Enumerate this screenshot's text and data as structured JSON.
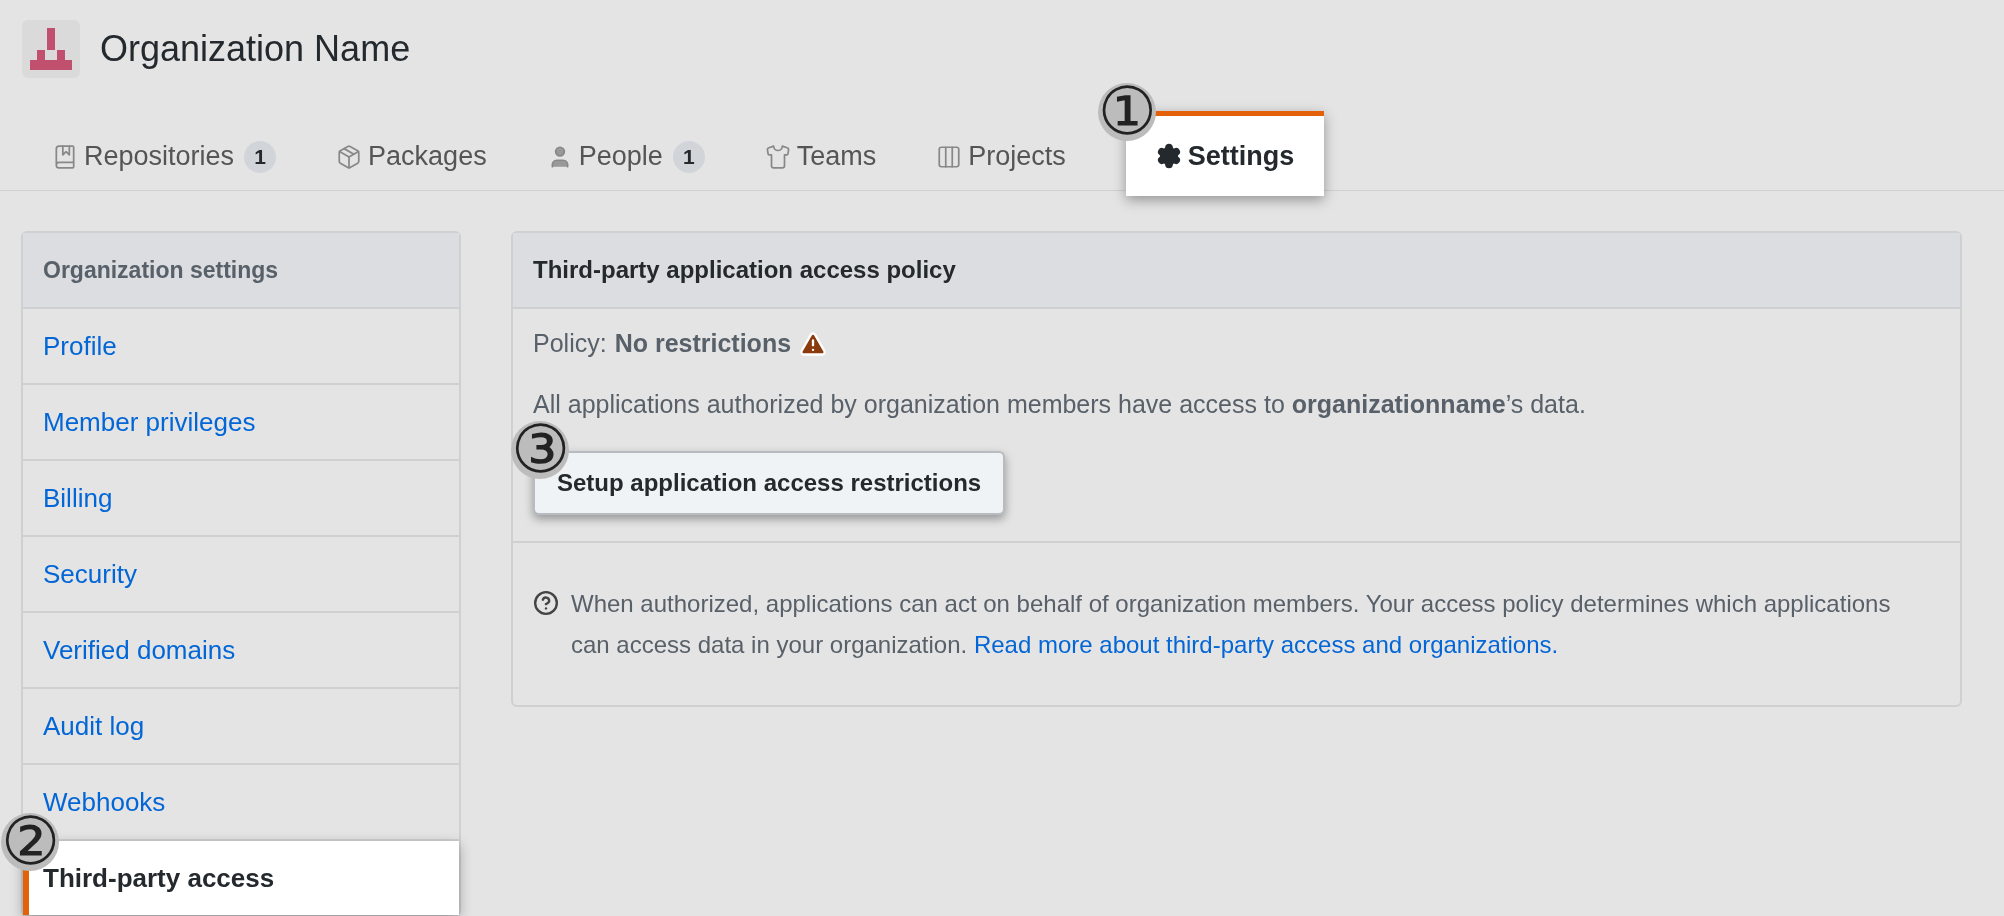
{
  "org": {
    "name": "Organization Name"
  },
  "tabs": [
    {
      "label": "Repositories",
      "count": "1",
      "selected": false
    },
    {
      "label": "Packages",
      "selected": false
    },
    {
      "label": "People",
      "count": "1",
      "selected": false
    },
    {
      "label": "Teams",
      "selected": false
    },
    {
      "label": "Projects",
      "selected": false
    },
    {
      "label": "Settings",
      "selected": true,
      "callout": "①"
    }
  ],
  "sidebar": {
    "title": "Organization settings",
    "items": [
      {
        "label": "Profile",
        "selected": false
      },
      {
        "label": "Member privileges",
        "selected": false
      },
      {
        "label": "Billing",
        "selected": false
      },
      {
        "label": "Security",
        "selected": false
      },
      {
        "label": "Verified domains",
        "selected": false
      },
      {
        "label": "Audit log",
        "selected": false
      },
      {
        "label": "Webhooks",
        "selected": false
      },
      {
        "label": "Third-party access",
        "selected": true,
        "callout": "②"
      }
    ]
  },
  "panel": {
    "title": "Third-party application access policy",
    "policy": {
      "label": "Policy:",
      "value": "No restrictions"
    },
    "description": "All applications authorized by organization members have access to **organizationname**’s data.",
    "button": {
      "label": "Setup application access restrictions",
      "callout": "③"
    },
    "note": {
      "text": "When authorized, applications can act on behalf of organization members. Your access policy determines which applications can access data in your organization.",
      "link": "Read more about third-party access and organizations."
    }
  }
}
